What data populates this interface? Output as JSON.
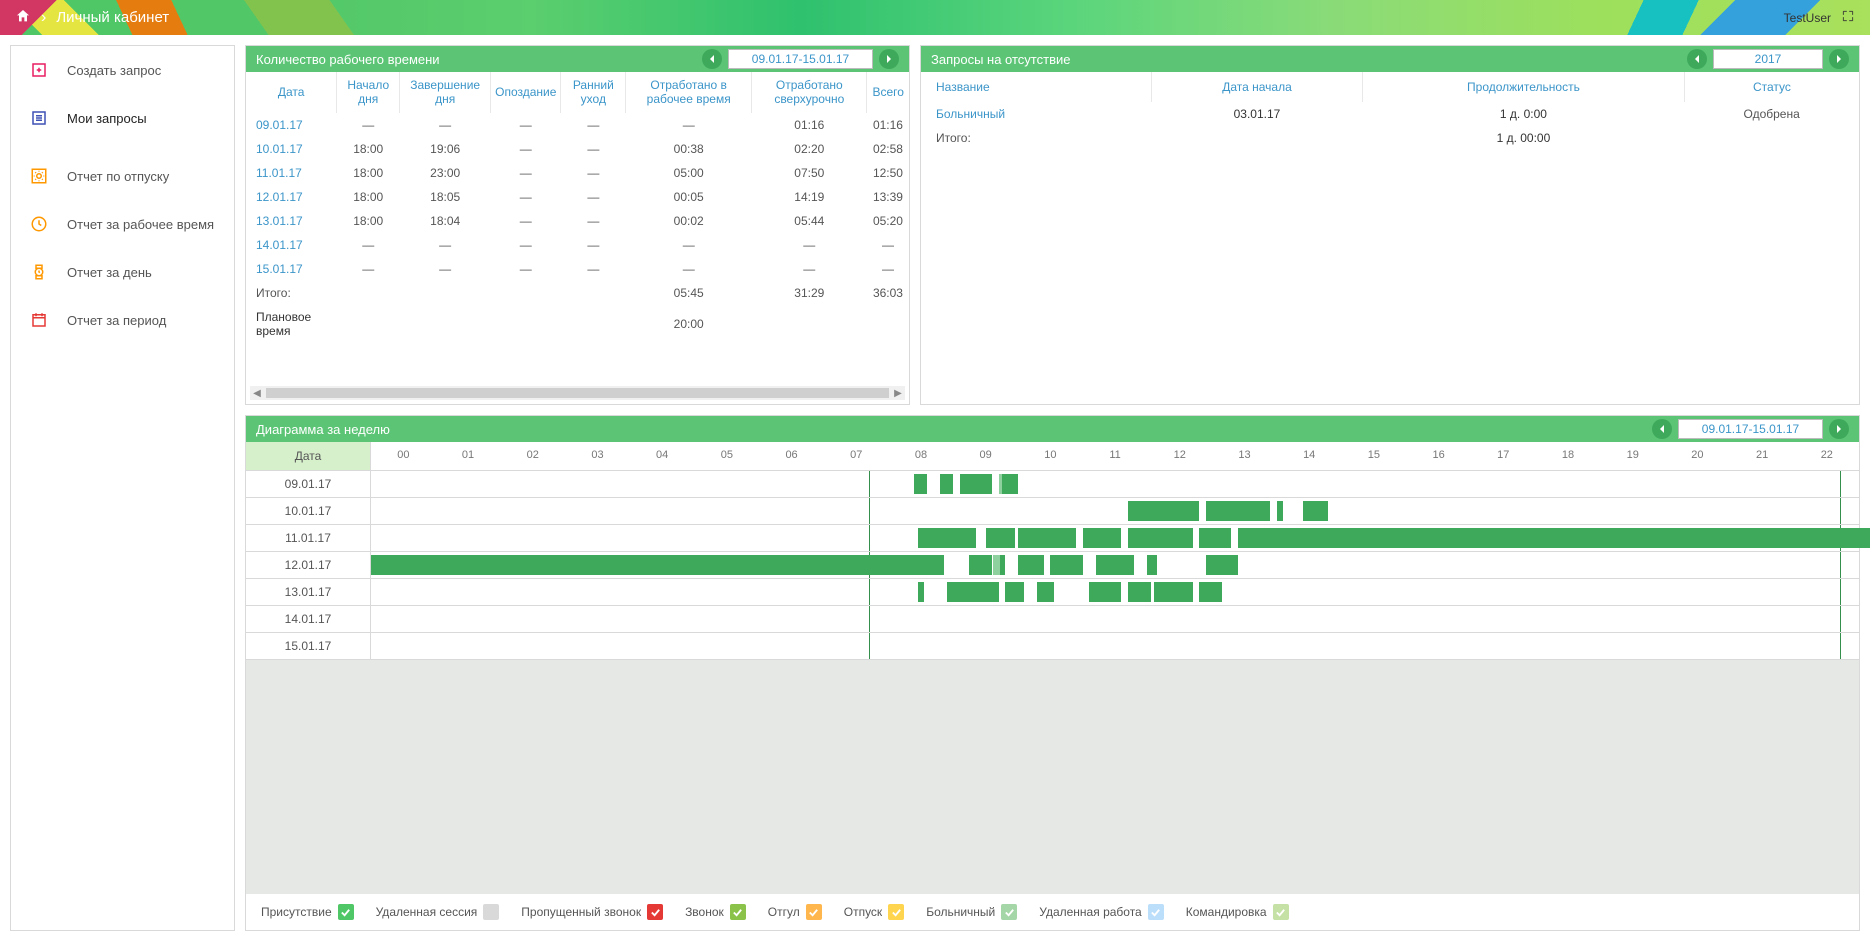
{
  "header": {
    "title": "Личный кабинет",
    "user": "TestUser"
  },
  "sidebar": {
    "items": [
      {
        "label": "Создать запрос",
        "icon": "create"
      },
      {
        "label": "Мои запросы",
        "icon": "list",
        "active": true
      },
      {
        "label": "Отчет по отпуску",
        "icon": "sun"
      },
      {
        "label": "Отчет за рабочее время",
        "icon": "clock"
      },
      {
        "label": "Отчет за день",
        "icon": "watch"
      },
      {
        "label": "Отчет за период",
        "icon": "calendar"
      }
    ]
  },
  "worktime": {
    "title": "Количество рабочего времени",
    "range": "09.01.17-15.01.17",
    "cols": [
      "Дата",
      "Начало дня",
      "Завершение дня",
      "Опоздание",
      "Ранний уход",
      "Отработано в рабочее время",
      "Отработано сверхурочно",
      "Всего"
    ],
    "rows": [
      {
        "date": "09.01.17",
        "start": "—",
        "end": "—",
        "late": "—",
        "early": "—",
        "worked": "—",
        "over": "01:16",
        "total": "01:16"
      },
      {
        "date": "10.01.17",
        "start": "18:00",
        "end": "19:06",
        "late": "—",
        "early": "—",
        "worked": "00:38",
        "over": "02:20",
        "total": "02:58"
      },
      {
        "date": "11.01.17",
        "start": "18:00",
        "end": "23:00",
        "late": "—",
        "early": "—",
        "worked": "05:00",
        "over": "07:50",
        "total": "12:50"
      },
      {
        "date": "12.01.17",
        "start": "18:00",
        "end": "18:05",
        "late": "—",
        "early": "—",
        "worked": "00:05",
        "over": "14:19",
        "total": "13:39"
      },
      {
        "date": "13.01.17",
        "start": "18:00",
        "end": "18:04",
        "late": "—",
        "early": "—",
        "worked": "00:02",
        "over": "05:44",
        "total": "05:20"
      },
      {
        "date": "14.01.17",
        "start": "—",
        "end": "—",
        "late": "—",
        "early": "—",
        "worked": "—",
        "over": "—",
        "total": "—"
      },
      {
        "date": "15.01.17",
        "start": "—",
        "end": "—",
        "late": "—",
        "early": "—",
        "worked": "—",
        "over": "—",
        "total": "—"
      }
    ],
    "totals": {
      "label": "Итого:",
      "worked": "05:45",
      "over": "31:29",
      "total": "36:03"
    },
    "plan": {
      "label": "Плановое время",
      "worked": "20:00"
    }
  },
  "absence": {
    "title": "Запросы на отсутствие",
    "range": "2017",
    "cols": [
      "Название",
      "Дата начала",
      "Продолжительность",
      "Статус"
    ],
    "rows": [
      {
        "name": "Больничный",
        "start": "03.01.17",
        "dur": "1 д. 0:00",
        "status": "Одобрена"
      }
    ],
    "totals": {
      "label": "Итого:",
      "dur": "1 д. 00:00"
    }
  },
  "diagram": {
    "title": "Диаграмма за неделю",
    "range": "09.01.17-15.01.17",
    "date_col": "Дата",
    "hours": [
      "00",
      "01",
      "02",
      "03",
      "04",
      "05",
      "06",
      "07",
      "08",
      "09",
      "10",
      "11",
      "12",
      "13",
      "14",
      "15",
      "16",
      "17",
      "18",
      "19",
      "20",
      "21",
      "22"
    ],
    "vlines_at": [
      7.7,
      22.7
    ],
    "rows": [
      {
        "date": "09.01.17",
        "segs": [
          {
            "s": 8.4,
            "e": 8.6
          },
          {
            "s": 8.8,
            "e": 9.0
          },
          {
            "s": 9.1,
            "e": 9.6
          },
          {
            "s": 9.7,
            "e": 9.75,
            "light": true
          },
          {
            "s": 9.75,
            "e": 10.0
          }
        ]
      },
      {
        "date": "10.01.17",
        "segs": [
          {
            "s": 11.7,
            "e": 12.8
          },
          {
            "s": 12.9,
            "e": 13.9
          },
          {
            "s": 14.0,
            "e": 14.1
          },
          {
            "s": 14.4,
            "e": 14.8
          }
        ]
      },
      {
        "date": "11.01.17",
        "segs": [
          {
            "s": 8.45,
            "e": 9.35
          },
          {
            "s": 9.5,
            "e": 9.95
          },
          {
            "s": 10.0,
            "e": 10.9
          },
          {
            "s": 11.0,
            "e": 11.6
          },
          {
            "s": 11.7,
            "e": 12.7
          },
          {
            "s": 12.8,
            "e": 13.3
          },
          {
            "s": 13.4,
            "e": 24.0
          }
        ]
      },
      {
        "date": "12.01.17",
        "segs": [
          {
            "s": 0.0,
            "e": 8.85
          },
          {
            "s": 9.25,
            "e": 9.6
          },
          {
            "s": 9.62,
            "e": 9.72,
            "light": true
          },
          {
            "s": 9.72,
            "e": 9.8
          },
          {
            "s": 10.0,
            "e": 10.4
          },
          {
            "s": 10.5,
            "e": 11.0
          },
          {
            "s": 11.2,
            "e": 11.8
          },
          {
            "s": 12.0,
            "e": 12.15
          },
          {
            "s": 12.9,
            "e": 13.4
          }
        ]
      },
      {
        "date": "13.01.17",
        "segs": [
          {
            "s": 8.45,
            "e": 8.55
          },
          {
            "s": 8.9,
            "e": 9.7
          },
          {
            "s": 9.8,
            "e": 10.1
          },
          {
            "s": 10.3,
            "e": 10.55
          },
          {
            "s": 11.1,
            "e": 11.6
          },
          {
            "s": 11.7,
            "e": 12.05
          },
          {
            "s": 12.1,
            "e": 12.7
          },
          {
            "s": 12.8,
            "e": 13.15
          }
        ]
      },
      {
        "date": "14.01.17",
        "segs": []
      },
      {
        "date": "15.01.17",
        "segs": []
      }
    ]
  },
  "legend": [
    {
      "label": "Присутствие",
      "color": "#4fc767",
      "check": true
    },
    {
      "label": "Удаленная сессия",
      "color": "#d9d9d9",
      "check": false
    },
    {
      "label": "Пропущенный звонок",
      "color": "#e53935",
      "check": true
    },
    {
      "label": "Звонок",
      "color": "#8bc34a",
      "check": true
    },
    {
      "label": "Отгул",
      "color": "#ffb74d",
      "check": true
    },
    {
      "label": "Отпуск",
      "color": "#ffd54f",
      "check": true
    },
    {
      "label": "Больничный",
      "color": "#a5d6a7",
      "check": true
    },
    {
      "label": "Удаленная работа",
      "color": "#bbdefb",
      "check": true
    },
    {
      "label": "Командировка",
      "color": "#c5e1a5",
      "check": true
    }
  ]
}
